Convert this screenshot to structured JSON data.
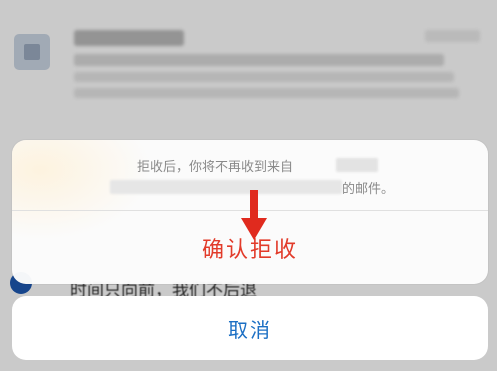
{
  "background": {
    "footer_text": "时间只向前，我们不后退"
  },
  "sheet": {
    "message_line1": "拒收后，你将不再收到来自",
    "message_line2": "的邮件。",
    "confirm_label": "确认拒收",
    "confirm_color": "#e23b2a"
  },
  "cancel": {
    "label": "取消",
    "color": "#1b6fc4"
  },
  "annotation": {
    "icon": "down-arrow-icon",
    "color": "#e02a1e"
  }
}
